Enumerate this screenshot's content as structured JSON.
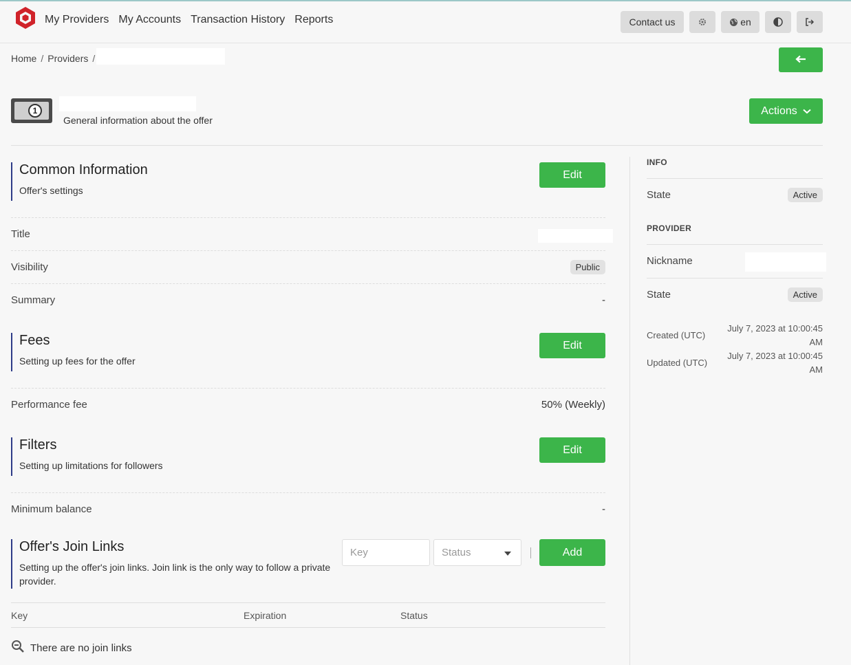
{
  "header": {
    "nav": [
      "My Providers",
      "My Accounts",
      "Transaction History",
      "Reports"
    ],
    "contact_label": "Contact us",
    "lang_label": "en"
  },
  "breadcrumb": {
    "home": "Home",
    "providers": "Providers"
  },
  "page": {
    "subtitle": "General information about the offer",
    "actions_label": "Actions"
  },
  "common": {
    "title": "Common Information",
    "subtitle": "Offer's settings",
    "edit_label": "Edit",
    "rows": {
      "title_label": "Title",
      "visibility_label": "Visibility",
      "visibility_value": "Public",
      "summary_label": "Summary",
      "summary_value": "-"
    }
  },
  "fees": {
    "title": "Fees",
    "subtitle": "Setting up fees for the offer",
    "edit_label": "Edit",
    "performance_label": "Performance fee",
    "performance_value": "50% (Weekly)"
  },
  "filters": {
    "title": "Filters",
    "subtitle": "Setting up limitations for followers",
    "edit_label": "Edit",
    "min_balance_label": "Minimum balance",
    "min_balance_value": "-"
  },
  "join_links": {
    "title": "Offer's Join Links",
    "subtitle": "Setting up the offer's join links. Join link is the only way to follow a private provider.",
    "key_placeholder": "Key",
    "status_placeholder": "Status",
    "add_label": "Add",
    "columns": [
      "Key",
      "Expiration",
      "Status"
    ],
    "empty_text": "There are no join links"
  },
  "sidebar": {
    "info_title": "INFO",
    "info_state_label": "State",
    "info_state_value": "Active",
    "provider_title": "PROVIDER",
    "nickname_label": "Nickname",
    "provider_state_label": "State",
    "provider_state_value": "Active",
    "created_label": "Created (UTC)",
    "created_value": "July 7, 2023 at 10:00:45 AM",
    "updated_label": "Updated (UTC)",
    "updated_value": "July 7, 2023 at 10:00:45 AM"
  },
  "colors": {
    "accent_green": "#3cb54a",
    "section_bar": "#2d3b87",
    "logo_red": "#d0232a"
  }
}
